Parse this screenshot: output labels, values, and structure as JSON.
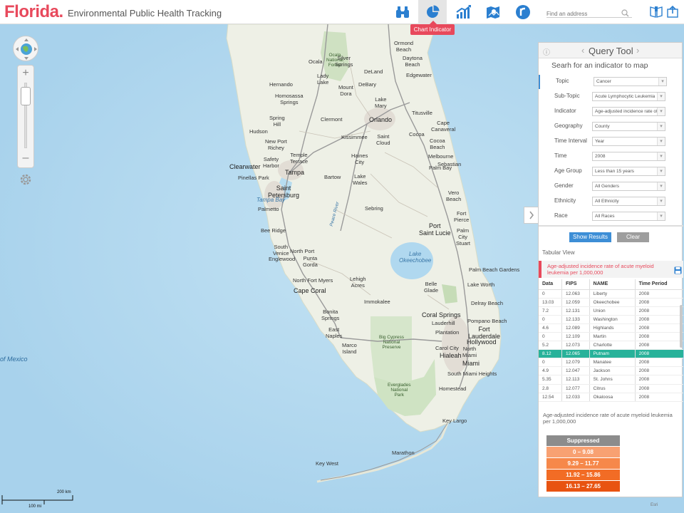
{
  "header": {
    "brand": "Florida.",
    "subtitle": "Environmental Public Health Tracking",
    "toolbar": [
      {
        "icon": "binoculars-icon",
        "label": "Explore"
      },
      {
        "icon": "pie-chart-icon",
        "label": "Chart Indicator",
        "active": true
      },
      {
        "icon": "line-chart-icon",
        "label": "Trend"
      },
      {
        "icon": "map-icon",
        "label": "Map"
      },
      {
        "icon": "r-icon",
        "label": "Reports"
      }
    ],
    "tooltip": "Chart Indicator",
    "search_placeholder": "Find an address",
    "icons": [
      "search-icon",
      "book-icon",
      "share-icon"
    ],
    "brand_color": "#e8495c"
  },
  "map": {
    "labels": {
      "gulf": "of Mexico",
      "tampa_bay": "Tampa Bay",
      "okeechobee": "Lake\nOkeechobee",
      "ocala_forest": "Ocala\nNational\nForest",
      "big_cypress": "Big Cypress\nNational\nPreserve",
      "everglades": "Everglades\nNational\nPark",
      "peace_river": "Peace River"
    },
    "cities": {
      "ormond": "Ormond\nBeach",
      "daytona": "Daytona\nBeach",
      "ocala": "Ocala",
      "silver": "Silver\nSprings",
      "deland": "DeLand",
      "edgewater": "Edgewater",
      "lady_lake": "Lady\nLake",
      "hernando": "Hernando",
      "mount_dora": "Mount\nDora",
      "debary": "DeBary",
      "homosassa": "Homosassa\nSprings",
      "lake_mary": "Lake\nMary",
      "titusville": "Titusville",
      "orlando": "Orlando",
      "clermont": "Clermont",
      "spring_hill": "Spring\nHill",
      "cape_canaveral": "Cape\nCanaveral",
      "hudson": "Hudson",
      "kissimmee": "Kissimmee",
      "st_cloud": "Saint\nCloud",
      "cocoa": "Cocoa",
      "new_port_richey": "New Port\nRichey",
      "cocoa_beach": "Cocoa\nBeach",
      "temple_terrace": "Temple\nTerrace",
      "safety_harbor": "Safety\nHarbor",
      "haines_city": "Haines\nCity",
      "melbourne": "Melbourne",
      "palm_bay": "Palm Bay",
      "clearwater": "Clearwater",
      "tampa": "Tampa",
      "pinellas_park": "Pinellas Park",
      "bartow": "Bartow",
      "lake_wales": "Lake\nWales",
      "sebastian": "Sebastian",
      "st_petersburg": "Saint\nPetersburg",
      "vero_beach": "Vero\nBeach",
      "palmetto": "Palmetto",
      "sebring": "Sebring",
      "fort_pierce": "Fort\nPierce",
      "bee_ridge": "Bee Ridge",
      "port_st_lucie": "Port\nSaint Lucie",
      "palm_city": "Palm\nCity",
      "south_venice": "South\nVenice",
      "north_port": "North Port",
      "englewood": "Englewood",
      "punta_gorda": "Punta\nGorda",
      "stuart": "Stuart",
      "pbg": "Palm Beach Gardens",
      "north_fort_myers": "North Fort Myers",
      "lehigh": "Lehigh\nAcres",
      "belle_glade": "Belle\nGlade",
      "cape_coral": "Cape Coral",
      "lake_worth": "Lake Worth",
      "delray": "Delray Beach",
      "immokalee": "Immokalee",
      "bonita": "Bonita\nSprings",
      "coral_springs": "Coral Springs",
      "pompano": "Pompano Beach",
      "lauderhill": "Lauderhill",
      "fort_lauderdale": "Fort\nLauderdale",
      "east_naples": "East\nNaples",
      "plantation": "Plantation",
      "hollywood": "Hollywood",
      "marco": "Marco\nIsland",
      "carol_city": "Carol City",
      "hialeah": "Hialeah",
      "north_miami": "North\nMiami",
      "miami": "Miami",
      "south_miami_heights": "South Miami Heights",
      "homestead": "Homestead",
      "key_largo": "Key Largo",
      "marathon": "Marathon",
      "key_west": "Key West"
    },
    "scale": {
      "km": "200 km",
      "mi": "100 mi"
    },
    "attribution": "Esri"
  },
  "panel": {
    "title": "Query Tool",
    "subtitle": "Searh for an indicator to map",
    "fields": [
      {
        "label": "Topic",
        "value": "Cancer"
      },
      {
        "label": "Sub-Topic",
        "value": "Acute Lymphocytic Leukemia"
      },
      {
        "label": "Indicator",
        "value": "Age-adjusted incidence rate of acute myeloid leukemia"
      },
      {
        "label": "Geography",
        "value": "County"
      },
      {
        "label": "Time Interval",
        "value": "Year"
      },
      {
        "label": "Time",
        "value": "2008"
      },
      {
        "label": "Age Group",
        "value": "Less than 15 years"
      },
      {
        "label": "Gender",
        "value": "All Genders"
      },
      {
        "label": "Ethnicity",
        "value": "All Ethnicity"
      },
      {
        "label": "Race",
        "value": "All Races"
      }
    ],
    "show_label": "Show Results",
    "clear_label": "Clear",
    "tabular_label": "Tabular View",
    "indicator_title": "Age-adjusted incidence rate of acute myeloid leukemia per 1,000,000",
    "columns": [
      "Data",
      "FIPS",
      "NAME",
      "Time Period"
    ],
    "rows": [
      [
        "0",
        "12.063",
        "Liberty",
        "2008"
      ],
      [
        "13.03",
        "12.059",
        "Okeechobee",
        "2008"
      ],
      [
        "7.2",
        "12.131",
        "Union",
        "2008"
      ],
      [
        "0",
        "12.133",
        "Washington",
        "2008"
      ],
      [
        "4.6",
        "12.089",
        "Highlands",
        "2008"
      ],
      [
        "0",
        "12.109",
        "Martin",
        "2008"
      ],
      [
        "5.2",
        "12.073",
        "Charlotte",
        "2008"
      ],
      [
        "8.12",
        "12.065",
        "Putnam",
        "2008"
      ],
      [
        "0",
        "12.079",
        "Manatee",
        "2008"
      ],
      [
        "4.9",
        "12.047",
        "Jackson",
        "2008"
      ],
      [
        "5.35",
        "12.113",
        "St. Johns",
        "2008"
      ],
      [
        "2.8",
        "12.077",
        "Citrus",
        "2008"
      ],
      [
        "12.54",
        "12.033",
        "Okaloosa",
        "2008"
      ]
    ],
    "highlight_row": 7,
    "highlight_color": "#28b29a",
    "footer": "Age-adjusted incidence rate of acute myeloid leukemia per 1,000,000",
    "legend": [
      {
        "label": "Suppressed",
        "color": "#8c8c8c"
      },
      {
        "label": "0 – 9.08",
        "color": "#f8a172"
      },
      {
        "label": "9.29 – 11.77",
        "color": "#f6884a"
      },
      {
        "label": "11.92 – 15.86",
        "color": "#f26c25"
      },
      {
        "label": "16.13 – 27.65",
        "color": "#e85311"
      }
    ]
  }
}
